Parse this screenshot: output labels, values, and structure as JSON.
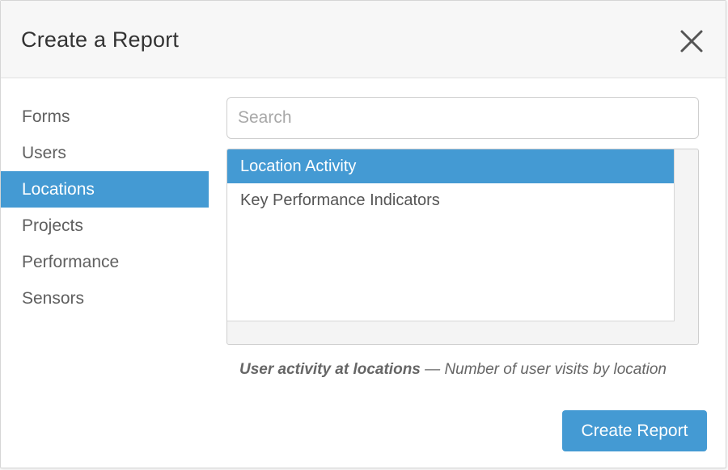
{
  "dialog": {
    "title": "Create a Report",
    "close_icon": "close-icon"
  },
  "sidebar": {
    "items": [
      {
        "label": "Forms",
        "active": false
      },
      {
        "label": "Users",
        "active": false
      },
      {
        "label": "Locations",
        "active": true
      },
      {
        "label": "Projects",
        "active": false
      },
      {
        "label": "Performance",
        "active": false
      },
      {
        "label": "Sensors",
        "active": false
      }
    ]
  },
  "search": {
    "placeholder": "Search",
    "value": ""
  },
  "reports": {
    "items": [
      {
        "label": "Location Activity",
        "selected": true
      },
      {
        "label": "Key Performance Indicators",
        "selected": false
      }
    ]
  },
  "description": {
    "title": "User activity at locations",
    "separator": " — ",
    "text": "Number of user visits by location"
  },
  "actions": {
    "create_label": "Create Report"
  },
  "colors": {
    "accent": "#449ad3",
    "header_bg": "#f7f7f7",
    "text": "#606060"
  }
}
